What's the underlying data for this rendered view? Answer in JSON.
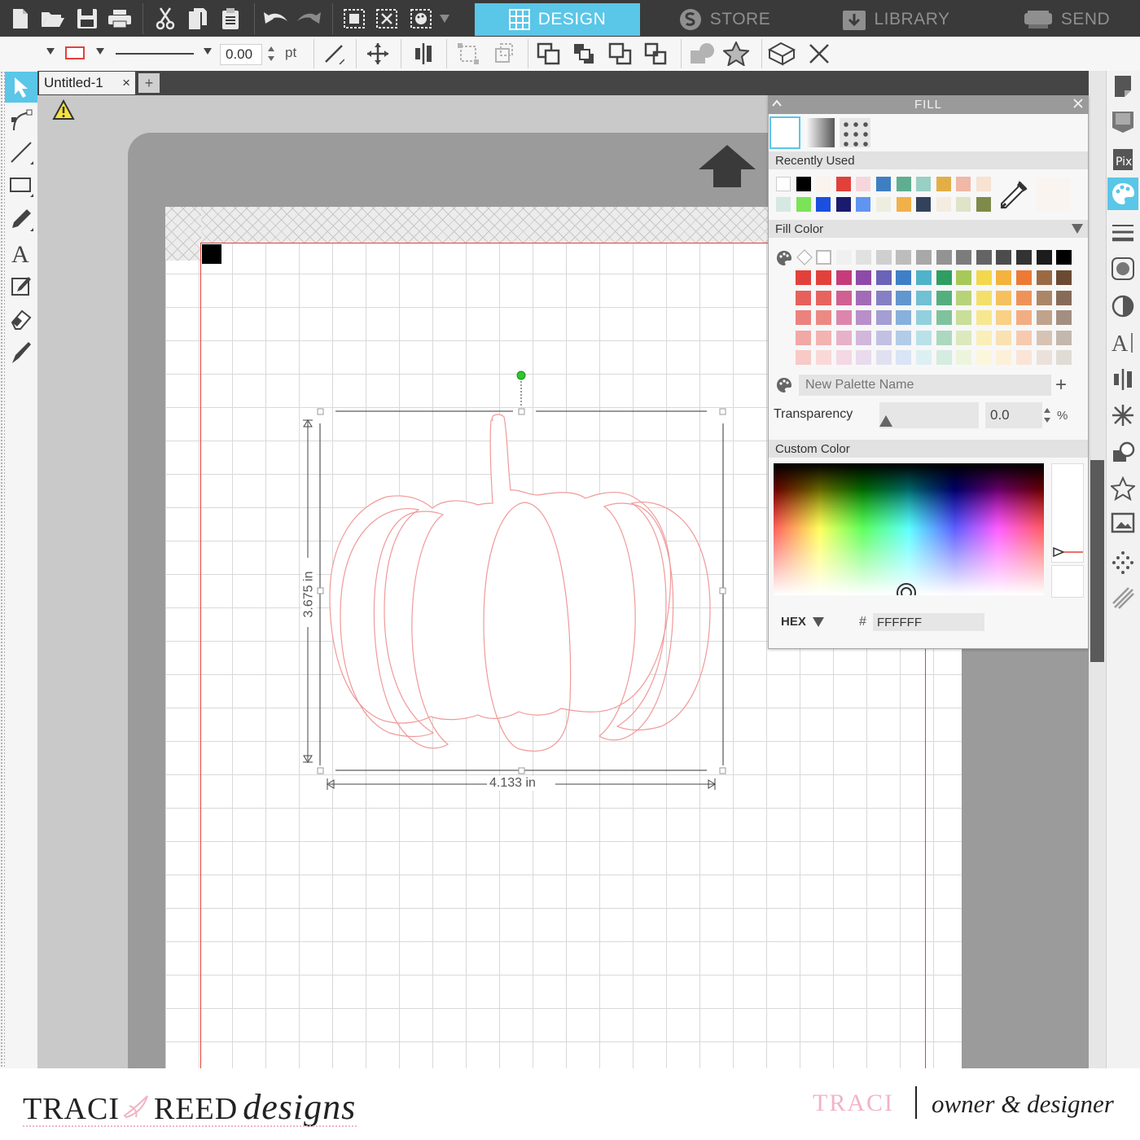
{
  "app": {
    "nav_tabs": [
      {
        "label": "DESIGN",
        "active": true
      },
      {
        "label": "STORE",
        "active": false
      },
      {
        "label": "LIBRARY",
        "active": false
      },
      {
        "label": "SEND",
        "active": false
      }
    ]
  },
  "toolbar2": {
    "line_width_value": "0.00",
    "line_width_unit": "pt"
  },
  "document": {
    "tab_title": "Untitled-1",
    "close_glyph": "×",
    "add_glyph": "+"
  },
  "canvas": {
    "height_label": "3.675 in",
    "width_label": "4.133 in"
  },
  "fill_panel": {
    "title": "FILL",
    "recently_used_label": "Recently Used",
    "fill_color_label": "Fill Color",
    "palette_name_placeholder": "New Palette Name",
    "add_glyph": "+",
    "transparency_label": "Transparency",
    "transparency_value": "0.0",
    "transparency_unit": "%",
    "custom_color_label": "Custom Color",
    "color_mode": "HEX",
    "hash_glyph": "#",
    "hex_value": "FFFFFF",
    "recent_colors_row1": [
      "#ffffff",
      "#000000",
      "#faf3ee",
      "#e2413b",
      "#f6d6dc",
      "#3e7ec3",
      "#5fae8f",
      "#99cfc4",
      "#e3ae45",
      "#f0b8a5",
      "#f8e2d2"
    ],
    "recent_colors_row2": [
      "#d6e8e4",
      "#7be356",
      "#1b4fe0",
      "#1a1a6e",
      "#5f95f0",
      "#eeeee0",
      "#f2b04a",
      "#33425b",
      "#f3ece0",
      "#dfe3c8",
      "#7d8a4a"
    ],
    "grid_row0": [
      "#ffffff",
      "#f0f0f0",
      "#e1e1e1",
      "#cfcfcf",
      "#bdbdbd",
      "#a8a8a8",
      "#939393",
      "#7c7c7c",
      "#646464",
      "#4c4c4c",
      "#333333",
      "#1c1c1c",
      "#000000"
    ],
    "grid_hue_base": [
      "#e2413b",
      "#c63c7a",
      "#8e4aa8",
      "#6a63b8",
      "#3f7fc6",
      "#4fb3c9",
      "#2f9e62",
      "#a7c95a",
      "#f2d84a",
      "#f3b33c",
      "#ec7a35",
      "#9a6a44",
      "#6b4a33"
    ]
  },
  "footer": {
    "brand_left": "TRACI",
    "brand_mid": "REED",
    "brand_script": "designs",
    "name_right": "TRACI",
    "role": "owner & designer"
  },
  "colors": {
    "accent": "#5ac6e8",
    "cut_line": "#e2413b",
    "rotate_handle": "#2fc52f",
    "brand_pink": "#f1b4c6"
  }
}
